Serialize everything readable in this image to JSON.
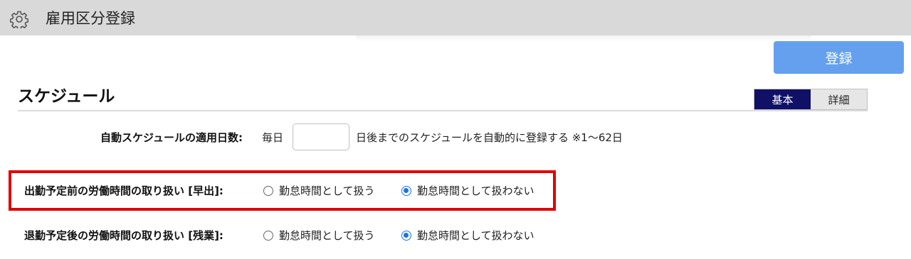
{
  "header": {
    "title": "雇用区分登録",
    "icon": "gear-icon"
  },
  "toolbar": {
    "register_label": "登録"
  },
  "section": {
    "title": "スケジュール",
    "view_toggle": {
      "basic_label": "基本",
      "detail_label": "詳細",
      "selected": "基本"
    }
  },
  "auto_schedule": {
    "label": "自動スケジュールの適用日数:",
    "prefix": "毎日",
    "value": "",
    "suffix": "日後までのスケジュールを自動的に登録する ※1～62日"
  },
  "early_work": {
    "label": "出勤予定前の労働時間の取り扱い [早出]:",
    "option_treat": "勤怠時間として扱う",
    "option_not_treat": "勤怠時間として扱わない",
    "selected": "option_not_treat"
  },
  "overtime": {
    "label": "退勤予定後の労働時間の取り扱い [残業]:",
    "option_treat": "勤怠時間として扱う",
    "option_not_treat": "勤怠時間として扱わない",
    "selected": "option_not_treat"
  },
  "colors": {
    "titlebar_bg": "#d9d9d9",
    "register_button_bg": "#64a0ee",
    "toggle_active_bg": "#0f1066",
    "highlight_border": "#e00000",
    "radio_checked": "#1a73e8"
  }
}
